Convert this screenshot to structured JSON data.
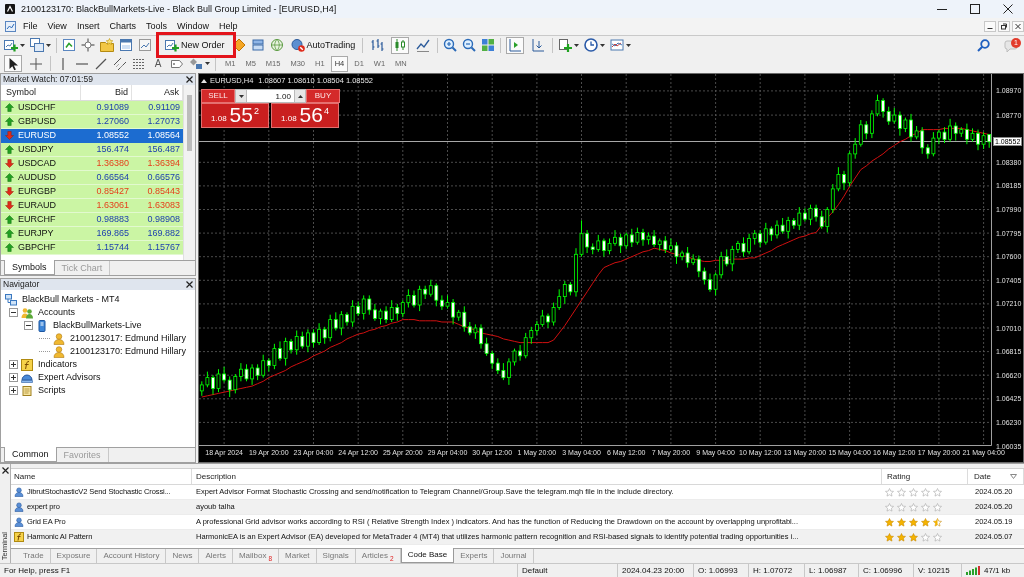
{
  "window": {
    "title": "2100123170: BlackBullMarkets-Live - Black Bull Group Limited - [EURUSD,H4]"
  },
  "menu": [
    "File",
    "View",
    "Insert",
    "Charts",
    "Tools",
    "Window",
    "Help"
  ],
  "toolbar": {
    "new_order": "New Order",
    "auto_trading": {
      "label": "AutoTrading",
      "on": false
    },
    "chart_types": [
      {
        "selected": false
      },
      {
        "selected": true
      },
      {
        "selected": false
      }
    ],
    "chart_shift": {
      "on": true
    },
    "auto_scroll": {
      "on": false
    },
    "notifications": "1"
  },
  "chart_toolbar": {
    "pointers": [
      {
        "selected": true
      },
      {
        "selected": false
      }
    ],
    "text_tool": "A",
    "periods": [
      {
        "label": "M1",
        "selected": false
      },
      {
        "label": "M5",
        "selected": false
      },
      {
        "label": "M15",
        "selected": false
      },
      {
        "label": "M30",
        "selected": false
      },
      {
        "label": "H1",
        "selected": false
      },
      {
        "label": "H4",
        "selected": true
      },
      {
        "label": "D1",
        "selected": false
      },
      {
        "label": "W1",
        "selected": false
      },
      {
        "label": "MN",
        "selected": false
      }
    ]
  },
  "market_watch": {
    "title": "Market Watch: 07:01:59",
    "columns": [
      "Symbol",
      "Bid",
      "Ask"
    ],
    "rows": [
      {
        "symbol": "USDCHF",
        "bid": "0.91089",
        "ask": "0.91109",
        "kind": "up",
        "selected": false
      },
      {
        "symbol": "GBPUSD",
        "bid": "1.27060",
        "ask": "1.27073",
        "kind": "up",
        "selected": false
      },
      {
        "symbol": "EURUSD",
        "bid": "1.08552",
        "ask": "1.08564",
        "kind": "down",
        "selected": true
      },
      {
        "symbol": "USDJPY",
        "bid": "156.474",
        "ask": "156.487",
        "kind": "up",
        "selected": false
      },
      {
        "symbol": "USDCAD",
        "bid": "1.36380",
        "ask": "1.36394",
        "kind": "down",
        "selected": false
      },
      {
        "symbol": "AUDUSD",
        "bid": "0.66564",
        "ask": "0.66576",
        "kind": "up",
        "selected": false
      },
      {
        "symbol": "EURGBP",
        "bid": "0.85427",
        "ask": "0.85443",
        "kind": "down",
        "selected": false
      },
      {
        "symbol": "EURAUD",
        "bid": "1.63061",
        "ask": "1.63083",
        "kind": "down",
        "selected": false
      },
      {
        "symbol": "EURCHF",
        "bid": "0.98883",
        "ask": "0.98908",
        "kind": "up",
        "selected": false
      },
      {
        "symbol": "EURJPY",
        "bid": "169.865",
        "ask": "169.882",
        "kind": "up",
        "selected": false
      },
      {
        "symbol": "GBPCHF",
        "bid": "1.15744",
        "ask": "1.15767",
        "kind": "up",
        "selected": false
      }
    ],
    "tabs": [
      {
        "label": "Symbols",
        "selected": true
      },
      {
        "label": "Tick Chart",
        "selected": false
      }
    ]
  },
  "navigator": {
    "title": "Navigator",
    "tree": [
      {
        "label": "BlackBull Markets - MT4",
        "kind": "root",
        "children": [
          {
            "label": "Accounts",
            "kind": "accounts",
            "expanded": true,
            "children": [
              {
                "label": "BlackBullMarkets-Live",
                "kind": "server",
                "expanded": true,
                "children": [
                  {
                    "label": "2100123017: Edmund Hillary",
                    "kind": "account"
                  },
                  {
                    "label": "2100123170: Edmund Hillary",
                    "kind": "account"
                  }
                ]
              }
            ]
          },
          {
            "label": "Indicators",
            "kind": "indicators",
            "expanded": false
          },
          {
            "label": "Expert Advisors",
            "kind": "experts",
            "expanded": false
          },
          {
            "label": "Scripts",
            "kind": "scripts",
            "expanded": false
          }
        ]
      }
    ],
    "tabs": [
      {
        "label": "Common",
        "selected": true
      },
      {
        "label": "Favorites",
        "selected": false
      }
    ]
  },
  "chart": {
    "symbol": "EURUSD,H4",
    "ohlc": "1.08607 1.08610 1.08504 1.08552",
    "trade_panel": {
      "sell": "SELL",
      "buy": "BUY",
      "lot": "1.00",
      "sell_price": {
        "big_figure": "1.08",
        "pips": "55",
        "point": "2"
      },
      "buy_price": {
        "big_figure": "1.08",
        "pips": "56",
        "point": "4"
      }
    },
    "chart_data": {
      "type": "candlestick",
      "grid": true,
      "categories": [
        null,
        null,
        null,
        null,
        "18 Apr 2024",
        null,
        null,
        null,
        null,
        null,
        null,
        null,
        "19 Apr 20:00",
        null,
        null,
        null,
        null,
        null,
        null,
        null,
        "23 Apr 04:00",
        null,
        null,
        null,
        null,
        null,
        null,
        null,
        "24 Apr 12:00",
        null,
        null,
        null,
        null,
        null,
        null,
        null,
        "25 Apr 20:00",
        null,
        null,
        null,
        null,
        null,
        null,
        null,
        "29 Apr 04:00",
        null,
        null,
        null,
        null,
        null,
        null,
        null,
        "30 Apr 12:00",
        null,
        null,
        null,
        null,
        null,
        null,
        null,
        "1 May 20:00",
        null,
        null,
        null,
        null,
        null,
        null,
        null,
        "3 May 04:00",
        null,
        null,
        null,
        null,
        null,
        null,
        null,
        "6 May 12:00",
        null,
        null,
        null,
        null,
        null,
        null,
        null,
        "7 May 20:00",
        null,
        null,
        null,
        null,
        null,
        null,
        null,
        "9 May 04:00",
        null,
        null,
        null,
        null,
        null,
        null,
        null,
        "10 May 12:00",
        null,
        null,
        null,
        null,
        null,
        null,
        null,
        "13 May 20:00",
        null,
        null,
        null,
        null,
        null,
        null,
        null,
        "15 May 04:00",
        null,
        null,
        null,
        null,
        null,
        null,
        null,
        "16 May 12:00",
        null,
        null,
        null,
        null,
        null,
        null,
        null,
        "17 May 20:00",
        null,
        null,
        null,
        null,
        null,
        null,
        null,
        "21 May 04:00",
        null
      ],
      "ylim": [
        1.06035,
        1.0911
      ],
      "yticks": [
        {
          "value": 1.0897,
          "label": "1.08970"
        },
        {
          "value": 1.0877,
          "label": "1.08770"
        },
        {
          "value": 1.0838,
          "label": "1.08380"
        },
        {
          "value": 1.08185,
          "label": "1.08185"
        },
        {
          "value": 1.0799,
          "label": "1.07990"
        },
        {
          "value": 1.07795,
          "label": "1.07795"
        },
        {
          "value": 1.076,
          "label": "1.07600"
        },
        {
          "value": 1.07405,
          "label": "1.07405"
        },
        {
          "value": 1.0721,
          "label": "1.07210"
        },
        {
          "value": 1.0701,
          "label": "1.07010"
        },
        {
          "value": 1.06815,
          "label": "1.06815"
        },
        {
          "value": 1.0662,
          "label": "1.06620"
        },
        {
          "value": 1.06425,
          "label": "1.06425"
        },
        {
          "value": 1.0623,
          "label": "1.06230"
        },
        {
          "value": 1.06035,
          "label": "1.06035"
        }
      ],
      "ref_lines": [
        {
          "axis": "y",
          "value": 1.08552,
          "label": "1.08552"
        }
      ],
      "ohlc": [
        [
          1.0649,
          1.0657,
          1.0645,
          1.0654
        ],
        [
          1.0654,
          1.0665,
          1.0652,
          1.066
        ],
        [
          1.066,
          1.0662,
          1.0646,
          1.0651
        ],
        [
          1.0651,
          1.0667,
          1.0648,
          1.0663
        ],
        [
          1.0663,
          1.0669,
          1.0656,
          1.0658
        ],
        [
          1.0658,
          1.0661,
          1.0644,
          1.065
        ],
        [
          1.065,
          1.0663,
          1.0647,
          1.0661
        ],
        [
          1.0661,
          1.0672,
          1.0657,
          1.0667
        ],
        [
          1.0667,
          1.0671,
          1.0657,
          1.0659
        ],
        [
          1.0659,
          1.0671,
          1.0654,
          1.0668
        ],
        [
          1.0668,
          1.0671,
          1.0658,
          1.0662
        ],
        [
          1.0662,
          1.0679,
          1.066,
          1.0674
        ],
        [
          1.0674,
          1.0676,
          1.0665,
          1.067
        ],
        [
          1.067,
          1.0688,
          1.0667,
          1.0684
        ],
        [
          1.0684,
          1.069,
          1.0674,
          1.0676
        ],
        [
          1.0676,
          1.0693,
          1.067,
          1.069
        ],
        [
          1.069,
          1.0692,
          1.068,
          1.0683
        ],
        [
          1.0683,
          1.0699,
          1.0679,
          1.0694
        ],
        [
          1.0694,
          1.0698,
          1.0684,
          1.0686
        ],
        [
          1.0686,
          1.07,
          1.0681,
          1.0697
        ],
        [
          1.0697,
          1.07,
          1.0685,
          1.0689
        ],
        [
          1.0689,
          1.0705,
          1.0687,
          1.07
        ],
        [
          1.07,
          1.0702,
          1.0688,
          1.0693
        ],
        [
          1.0693,
          1.0712,
          1.069,
          1.0708
        ],
        [
          1.0708,
          1.0714,
          1.0699,
          1.0701
        ],
        [
          1.0701,
          1.0715,
          1.0695,
          1.0712
        ],
        [
          1.0712,
          1.0714,
          1.0703,
          1.0706
        ],
        [
          1.0706,
          1.0724,
          1.0702,
          1.0719
        ],
        [
          1.0719,
          1.0723,
          1.0711,
          1.0713
        ],
        [
          1.0713,
          1.0728,
          1.0708,
          1.0725
        ],
        [
          1.0725,
          1.0728,
          1.0712,
          1.0716
        ],
        [
          1.0716,
          1.0721,
          1.0707,
          1.0709
        ],
        [
          1.0709,
          1.0717,
          1.0704,
          1.0715
        ],
        [
          1.0715,
          1.0719,
          1.0705,
          1.0708
        ],
        [
          1.0708,
          1.0724,
          1.0706,
          1.0718
        ],
        [
          1.0718,
          1.0721,
          1.0707,
          1.0713
        ],
        [
          1.0713,
          1.0724,
          1.071,
          1.0722
        ],
        [
          1.0722,
          1.0733,
          1.0718,
          1.0728
        ],
        [
          1.0728,
          1.0732,
          1.0718,
          1.072
        ],
        [
          1.072,
          1.0736,
          1.0715,
          1.0733
        ],
        [
          1.0733,
          1.0736,
          1.0725,
          1.0729
        ],
        [
          1.0729,
          1.0741,
          1.0727,
          1.0736
        ],
        [
          1.0736,
          1.0738,
          1.0719,
          1.0724
        ],
        [
          1.0724,
          1.0728,
          1.0716,
          1.0719
        ],
        [
          1.0719,
          1.0728,
          1.0717,
          1.0722
        ],
        [
          1.0722,
          1.0725,
          1.0704,
          1.071
        ],
        [
          1.071,
          1.0716,
          1.0707,
          1.0714
        ],
        [
          1.0714,
          1.0719,
          1.0698,
          1.0702
        ],
        [
          1.0702,
          1.0706,
          1.0695,
          1.0697
        ],
        [
          1.0697,
          1.0704,
          1.0692,
          1.0701
        ],
        [
          1.0701,
          1.0704,
          1.0684,
          1.0688
        ],
        [
          1.0688,
          1.0693,
          1.0678,
          1.068
        ],
        [
          1.068,
          1.0682,
          1.0667,
          1.0672
        ],
        [
          1.0672,
          1.0676,
          1.0663,
          1.0666
        ],
        [
          1.0666,
          1.0672,
          1.0658,
          1.066
        ],
        [
          1.066,
          1.0676,
          1.0654,
          1.0673
        ],
        [
          1.0673,
          1.0684,
          1.067,
          1.0682
        ],
        [
          1.0682,
          1.0687,
          1.0674,
          1.0678
        ],
        [
          1.0678,
          1.0697,
          1.0676,
          1.0693
        ],
        [
          1.0693,
          1.0702,
          1.0688,
          1.0699
        ],
        [
          1.0699,
          1.0707,
          1.0695,
          1.0704
        ],
        [
          1.0704,
          1.0716,
          1.0702,
          1.0711
        ],
        [
          1.0711,
          1.0713,
          1.0701,
          1.0706
        ],
        [
          1.0706,
          1.0722,
          1.0703,
          1.0718
        ],
        [
          1.0718,
          1.0733,
          1.0716,
          1.0727
        ],
        [
          1.0727,
          1.074,
          1.0721,
          1.0737
        ],
        [
          1.0737,
          1.0739,
          1.0728,
          1.0731
        ],
        [
          1.0731,
          1.0767,
          1.0727,
          1.0762
        ],
        [
          1.0762,
          1.079,
          1.076,
          1.0779
        ],
        [
          1.0779,
          1.0782,
          1.0763,
          1.0768
        ],
        [
          1.0768,
          1.0771,
          1.0762,
          1.0766
        ],
        [
          1.0766,
          1.0778,
          1.0764,
          1.0773
        ],
        [
          1.0773,
          1.0775,
          1.076,
          1.0765
        ],
        [
          1.0765,
          1.0775,
          1.0762,
          1.0771
        ],
        [
          1.0771,
          1.0782,
          1.0769,
          1.0776
        ],
        [
          1.0776,
          1.0779,
          1.0763,
          1.0769
        ],
        [
          1.0769,
          1.078,
          1.0766,
          1.0778
        ],
        [
          1.0778,
          1.0783,
          1.0768,
          1.0772
        ],
        [
          1.0772,
          1.0784,
          1.077,
          1.078
        ],
        [
          1.078,
          1.0783,
          1.0769,
          1.0774
        ],
        [
          1.0774,
          1.078,
          1.077,
          1.0777
        ],
        [
          1.0777,
          1.0782,
          1.0768,
          1.077
        ],
        [
          1.077,
          1.0775,
          1.0765,
          1.0773
        ],
        [
          1.0773,
          1.0777,
          1.0763,
          1.0766
        ],
        [
          1.0766,
          1.0775,
          1.0764,
          1.0769
        ],
        [
          1.0769,
          1.0772,
          1.0754,
          1.076
        ],
        [
          1.076,
          1.0765,
          1.0757,
          1.0763
        ],
        [
          1.0763,
          1.0768,
          1.0751,
          1.0755
        ],
        [
          1.0755,
          1.0762,
          1.0753,
          1.0758
        ],
        [
          1.0758,
          1.0761,
          1.0743,
          1.0748
        ],
        [
          1.0748,
          1.0751,
          1.0737,
          1.0741
        ],
        [
          1.0741,
          1.0746,
          1.0731,
          1.0733
        ],
        [
          1.0733,
          1.0747,
          1.0728,
          1.0745
        ],
        [
          1.0745,
          1.0764,
          1.0742,
          1.076
        ],
        [
          1.076,
          1.0766,
          1.0752,
          1.0754
        ],
        [
          1.0754,
          1.0769,
          1.0748,
          1.0766
        ],
        [
          1.0766,
          1.0773,
          1.0763,
          1.0771
        ],
        [
          1.0771,
          1.0776,
          1.076,
          1.0764
        ],
        [
          1.0764,
          1.0779,
          1.0762,
          1.0775
        ],
        [
          1.0775,
          1.0782,
          1.077,
          1.0779
        ],
        [
          1.0779,
          1.0782,
          1.0768,
          1.0772
        ],
        [
          1.0772,
          1.0788,
          1.077,
          1.0783
        ],
        [
          1.0783,
          1.0785,
          1.0773,
          1.0778
        ],
        [
          1.0778,
          1.079,
          1.0775,
          1.0786
        ],
        [
          1.0786,
          1.0792,
          1.0779,
          1.0781
        ],
        [
          1.0781,
          1.0793,
          1.0775,
          1.079
        ],
        [
          1.079,
          1.0792,
          1.0783,
          1.0786
        ],
        [
          1.0786,
          1.0801,
          1.0782,
          1.0796
        ],
        [
          1.0796,
          1.08,
          1.0789,
          1.0791
        ],
        [
          1.0791,
          1.0803,
          1.0786,
          1.08
        ],
        [
          1.08,
          1.0803,
          1.0789,
          1.0793
        ],
        [
          1.0793,
          1.0798,
          1.0783,
          1.0785
        ],
        [
          1.0785,
          1.0801,
          1.078,
          1.0799
        ],
        [
          1.0799,
          1.082,
          1.0796,
          1.0816
        ],
        [
          1.0816,
          1.0834,
          1.0814,
          1.0828
        ],
        [
          1.0828,
          1.0831,
          1.0815,
          1.0821
        ],
        [
          1.0821,
          1.0847,
          1.0818,
          1.0845
        ],
        [
          1.0845,
          1.0858,
          1.0841,
          1.0853
        ],
        [
          1.0853,
          1.0873,
          1.0851,
          1.0869
        ],
        [
          1.0869,
          1.0872,
          1.0857,
          1.0862
        ],
        [
          1.0862,
          1.0881,
          1.0858,
          1.0878
        ],
        [
          1.0878,
          1.0894,
          1.0876,
          1.0889
        ],
        [
          1.0889,
          1.0891,
          1.0875,
          1.088
        ],
        [
          1.088,
          1.0884,
          1.0869,
          1.0872
        ],
        [
          1.0872,
          1.0883,
          1.087,
          1.0877
        ],
        [
          1.0877,
          1.088,
          1.086,
          1.0866
        ],
        [
          1.0866,
          1.0875,
          1.0863,
          1.0873
        ],
        [
          1.0873,
          1.0878,
          1.0855,
          1.0859
        ],
        [
          1.0859,
          1.0868,
          1.0857,
          1.0864
        ],
        [
          1.0864,
          1.0867,
          1.0845,
          1.085
        ],
        [
          1.085,
          1.0853,
          1.0841,
          1.0845
        ],
        [
          1.0845,
          1.0863,
          1.0843,
          1.0858
        ],
        [
          1.0858,
          1.0865,
          1.0853,
          1.0863
        ],
        [
          1.0863,
          1.0867,
          1.0854,
          1.0857
        ],
        [
          1.0857,
          1.0874,
          1.0855,
          1.0868
        ],
        [
          1.0868,
          1.0871,
          1.0856,
          1.0862
        ],
        [
          1.0862,
          1.0867,
          1.0859,
          1.0865
        ],
        [
          1.0865,
          1.087,
          1.0853,
          1.0857
        ],
        [
          1.0857,
          1.0866,
          1.0855,
          1.0862
        ],
        [
          1.0862,
          1.0865,
          1.0848,
          1.0853
        ],
        [
          1.0853,
          1.0863,
          1.0849,
          1.086
        ],
        [
          1.0861,
          1.0861,
          1.085,
          1.0855
        ]
      ],
      "series": [
        {
          "type": "line",
          "color": "#d01010",
          "values": [
            1.0644,
            1.0645,
            1.0646,
            1.0647,
            1.0648,
            1.0649,
            1.065,
            1.0651,
            1.0652,
            1.0653,
            1.0655,
            1.0657,
            1.066,
            1.0662,
            1.0664,
            1.0666,
            1.0669,
            1.0671,
            1.0673,
            1.0675,
            1.0678,
            1.068,
            1.0682,
            1.0685,
            1.0687,
            1.0689,
            1.0692,
            1.0694,
            1.0696,
            1.0697,
            1.0699,
            1.07,
            1.0702,
            1.0703,
            1.0705,
            1.0706,
            1.0708,
            1.0708,
            1.0708,
            1.0707,
            1.0707,
            1.0707,
            1.0707,
            1.0706,
            1.0706,
            1.0706,
            1.0704,
            1.0702,
            1.0701,
            1.0699,
            1.0697,
            1.0696,
            1.0695,
            1.0694,
            1.0692,
            1.0691,
            1.069,
            1.0689,
            1.0689,
            1.0689,
            1.0689,
            1.0689,
            1.0689,
            1.0691,
            1.0697,
            1.0703,
            1.071,
            1.0717,
            1.0724,
            1.0731,
            1.0738,
            1.0745,
            1.0751,
            1.0753,
            1.0755,
            1.0756,
            1.0758,
            1.076,
            1.0762,
            1.0764,
            1.0765,
            1.0767,
            1.0766,
            1.0765,
            1.0763,
            1.0762,
            1.0761,
            1.076,
            1.0758,
            1.0757,
            1.0756,
            1.0756,
            1.0757,
            1.0757,
            1.0757,
            1.0758,
            1.0758,
            1.0758,
            1.0759,
            1.0759,
            1.0761,
            1.0763,
            1.0765,
            1.0768,
            1.077,
            1.0772,
            1.0774,
            1.0776,
            1.0777,
            1.0779,
            1.078,
            1.0786,
            1.0792,
            1.0797,
            1.0803,
            1.081,
            1.0818,
            1.0825,
            1.0832,
            1.0835,
            1.0839,
            1.0842,
            1.0845,
            1.0849,
            1.0852,
            1.0855,
            1.0857,
            1.086,
            1.0862,
            1.0865,
            1.0865,
            1.0865,
            1.0865,
            1.0866,
            1.0866,
            1.0866,
            1.0866,
            1.0865,
            1.0864,
            1.0863,
            1.0862,
            1.0861
          ]
        }
      ]
    }
  },
  "terminal": {
    "title": "Terminal",
    "columns": [
      "Name",
      "Description",
      "Rating",
      "Date"
    ],
    "rows": [
      {
        "kind": "expert",
        "name": "JibrutStochasticV2 Send Stochastic Crossi...",
        "description": "Expert Advisor Format Stochastic Crossing and send/notification to Telegram Channel/Group.Save the telegram.mqh file in the include directory.",
        "stars": 0,
        "date": "2024.05.20"
      },
      {
        "kind": "expert",
        "name": "expert pro",
        "description": "ayoub talha",
        "stars": 0,
        "date": "2024.05.20"
      },
      {
        "kind": "expert",
        "name": "Grid EA Pro",
        "description": "A professional Grid advisor works according to RSI ( Relative Strength Index ) indicators. And has the function of Reducing the Drawdown on the account by overlapping unprofitabl...",
        "stars": 4.5,
        "date": "2024.05.19"
      },
      {
        "kind": "indicator",
        "name": "Harmonic AI Pattern",
        "description": "HarmonicEA is an Expert Advisor (EA) developed for MetaTrader 4 (MT4) that utilizes harmonic pattern recognition and RSI-based signals to identify potential trading opportunities i...",
        "stars": 3,
        "date": "2024.05.07"
      }
    ],
    "tabs": [
      {
        "label": "Trade",
        "selected": false
      },
      {
        "label": "Exposure",
        "selected": false
      },
      {
        "label": "Account History",
        "selected": false
      },
      {
        "label": "News",
        "selected": false
      },
      {
        "label": "Alerts",
        "selected": false
      },
      {
        "label": "Mailbox",
        "badge": "8",
        "selected": false
      },
      {
        "label": "Market",
        "selected": false
      },
      {
        "label": "Signals",
        "selected": false
      },
      {
        "label": "Articles",
        "badge": "2",
        "selected": false
      },
      {
        "label": "Code Base",
        "selected": true
      },
      {
        "label": "Experts",
        "selected": false
      },
      {
        "label": "Journal",
        "selected": false
      }
    ]
  },
  "status_bar": {
    "help": "For Help, press F1",
    "profile": "Default",
    "time": "2024.04.23 20:00",
    "open": "O: 1.06993",
    "high": "H: 1.07072",
    "low": "L: 1.06987",
    "close": "C: 1.06996",
    "volume": "V: 10215",
    "traffic": "47/1 kb"
  }
}
